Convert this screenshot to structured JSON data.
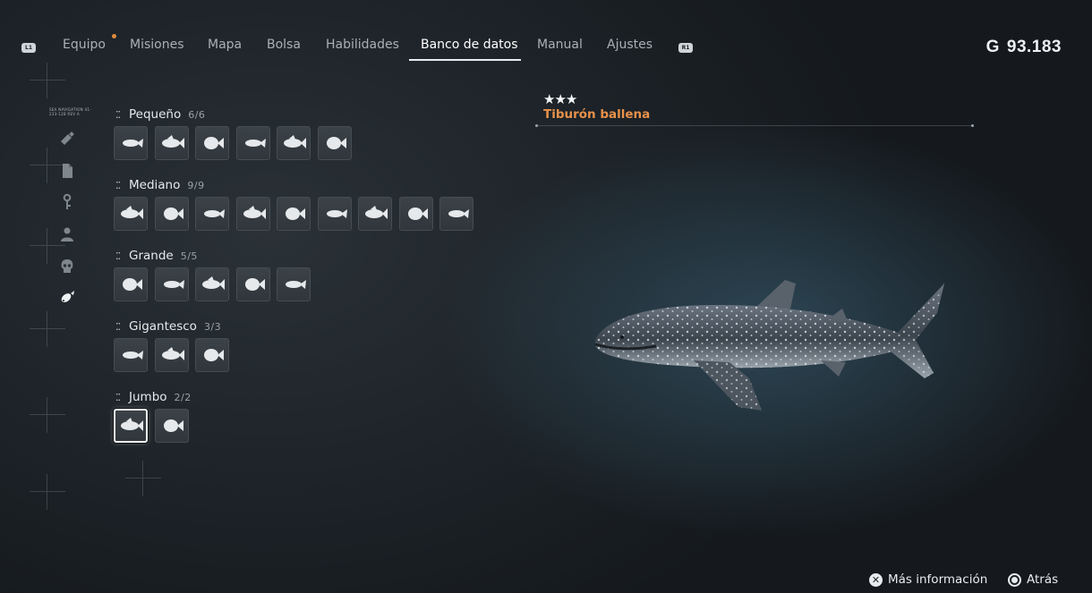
{
  "nav": {
    "left_trigger": "L1",
    "right_trigger": "R1",
    "tabs": [
      {
        "label": "Equipo",
        "active": false,
        "notification": true
      },
      {
        "label": "Misiones",
        "active": false
      },
      {
        "label": "Mapa",
        "active": false
      },
      {
        "label": "Bolsa",
        "active": false
      },
      {
        "label": "Habilidades",
        "active": false
      },
      {
        "label": "Banco de datos",
        "active": true
      },
      {
        "label": "Manual",
        "active": false
      },
      {
        "label": "Ajustes",
        "active": false
      }
    ],
    "currency_symbol": "G",
    "currency_value": "93.183"
  },
  "rail": {
    "label": "SEA NAVIGATION 41-233-128 REV A",
    "icons": [
      "whistle-icon",
      "document-icon",
      "key-icon",
      "person-icon",
      "skull-icon",
      "fish-icon"
    ],
    "active_icon": "fish-icon"
  },
  "categories": [
    {
      "name": "Pequeño",
      "count": "6/6",
      "slots": 6
    },
    {
      "name": "Mediano",
      "count": "9/9",
      "slots": 9
    },
    {
      "name": "Grande",
      "count": "5/5",
      "slots": 5
    },
    {
      "name": "Gigantesco",
      "count": "3/3",
      "slots": 3
    },
    {
      "name": "Jumbo",
      "count": "2/2",
      "slots": 2,
      "selected_index": 0
    }
  ],
  "detail": {
    "stars": "★★★",
    "name": "Tiburón ballena",
    "accent_color": "#e8914a"
  },
  "prompts": {
    "more_info": "Más información",
    "back": "Atrás"
  }
}
